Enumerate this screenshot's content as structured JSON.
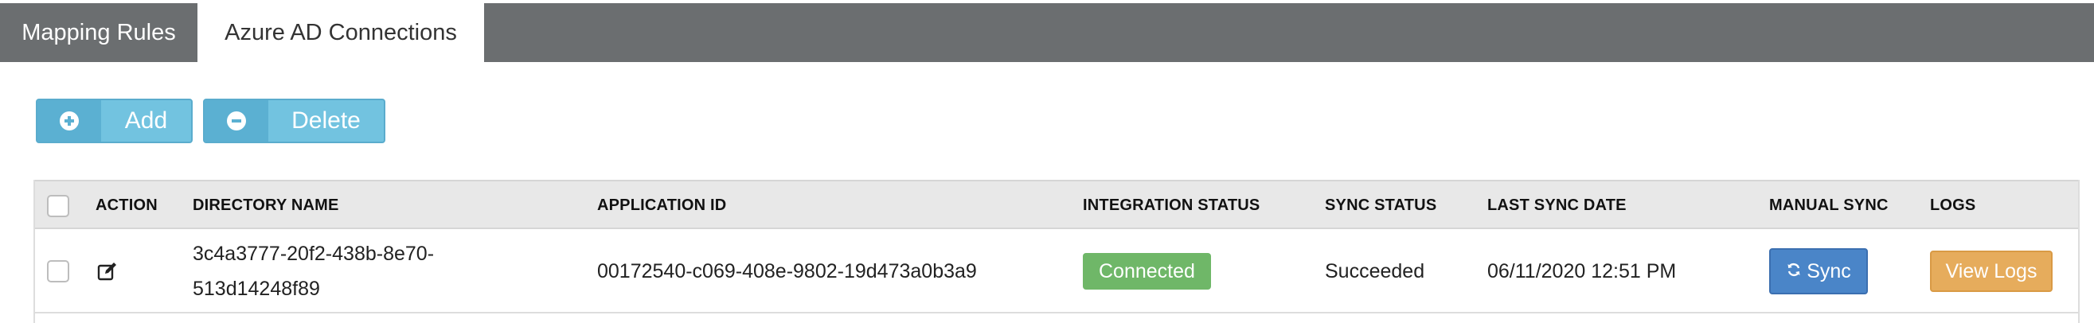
{
  "tabs": [
    {
      "label": "Mapping Rules",
      "active": false
    },
    {
      "label": "Azure AD Connections",
      "active": true
    }
  ],
  "toolbar": {
    "add_label": "Add",
    "add_icon": "plus-circle-icon",
    "delete_label": "Delete",
    "delete_icon": "minus-circle-icon"
  },
  "table": {
    "columns": [
      "ACTION",
      "DIRECTORY NAME",
      "APPLICATION ID",
      "INTEGRATION STATUS",
      "SYNC STATUS",
      "LAST SYNC DATE",
      "MANUAL SYNC",
      "LOGS"
    ],
    "rows": [
      {
        "action_icon": "edit-icon",
        "directory_name": "3c4a3777-20f2-438b-8e70-513d14248f89",
        "application_id": "00172540-c069-408e-9802-19d473a0b3a9",
        "integration_status": "Connected",
        "sync_status": "Succeeded",
        "last_sync_date": "06/11/2020 12:51 PM",
        "manual_sync_label": "Sync",
        "logs_label": "View Logs"
      }
    ]
  },
  "colors": {
    "tabbar": "#6b6e70",
    "toolbar_button": "#72c3e0",
    "connected_badge": "#6fb768",
    "sync_button": "#4a85c8",
    "logs_button": "#e6ac5c"
  }
}
